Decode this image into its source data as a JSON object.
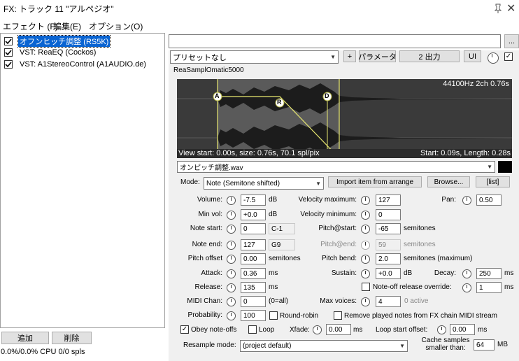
{
  "window": {
    "title": "FX: トラック 11 \"アルペジオ\""
  },
  "menu": [
    "エフェクト (F)",
    "編集(E)",
    "オプション(O)"
  ],
  "fx_list": [
    {
      "label": "オフンヒッチ調整 (RS5K)",
      "checked": true,
      "selected": true
    },
    {
      "label": "VST: ReaEQ (Cockos)",
      "checked": true,
      "selected": false
    },
    {
      "label": "VST: A1StereoControl (A1AUDIO.de)",
      "checked": true,
      "selected": false
    }
  ],
  "bottom": {
    "add_label": "追加",
    "remove_label": "削除",
    "cpu": "0.0%/0.0% CPU 0/0 spls"
  },
  "top_bar": {
    "preset_field": "",
    "more_label": "...",
    "preset": "プリセットなし",
    "plus_label": "+",
    "param_label": "パラメータ",
    "output_label": "2 出力",
    "ui_label": "UI"
  },
  "plugin": {
    "name": "ReaSamplOmatic5000"
  },
  "waveform": {
    "info": "44100Hz 2ch 0.76s",
    "view_info": "View start: 0.00s, size: 0.76s, 70.1 spl/pix",
    "sel_info": "Start: 0.09s, Length: 0.28s",
    "markers": {
      "a": "A",
      "r": "R",
      "d": "D"
    }
  },
  "file": {
    "name": "オンピッチ調整.wav"
  },
  "mode": {
    "label": "Mode:",
    "value": "Note (Semitone shifted)",
    "import_label": "Import item from arrange",
    "browse_label": "Browse...",
    "list_label": "[list]"
  },
  "params": {
    "volume": {
      "label": "Volume:",
      "value": "-7.5",
      "unit": "dB"
    },
    "min_vol": {
      "label": "Min vol:",
      "value": "+0.0",
      "unit": "dB"
    },
    "note_start": {
      "label": "Note start:",
      "value": "0",
      "note": "C-1"
    },
    "note_end": {
      "label": "Note end:",
      "value": "127",
      "note": "G9"
    },
    "pitch_offset": {
      "label": "Pitch offset",
      "value": "0.00",
      "unit": "semitones"
    },
    "attack": {
      "label": "Attack:",
      "value": "0.36",
      "unit": "ms"
    },
    "release": {
      "label": "Release:",
      "value": "135",
      "unit": "ms"
    },
    "midi_chan": {
      "label": "MIDI Chan:",
      "value": "0",
      "unit": "(0=all)"
    },
    "probability": {
      "label": "Probability:",
      "value": "100"
    },
    "vel_max": {
      "label": "Velocity maximum:",
      "value": "127"
    },
    "vel_min": {
      "label": "Velocity minimum:",
      "value": "0"
    },
    "pitch_start": {
      "label": "Pitch@start:",
      "value": "-65",
      "unit": "semitones"
    },
    "pitch_end": {
      "label": "Pitch@end:",
      "value": "59",
      "unit": "semitones"
    },
    "pitch_bend": {
      "label": "Pitch bend:",
      "value": "2.0",
      "unit": "semitones (maximum)"
    },
    "sustain": {
      "label": "Sustain:",
      "value": "+0.0",
      "unit": "dB"
    },
    "max_voices": {
      "label": "Max voices:",
      "value": "4",
      "unit": "0 active"
    },
    "pan": {
      "label": "Pan:",
      "value": "0.50"
    },
    "decay": {
      "label": "Decay:",
      "value": "250",
      "unit": "ms"
    },
    "noteoff_override": {
      "label": "Note-off release override:",
      "value": "1",
      "unit": "ms"
    },
    "xfade": {
      "label": "Xfade:",
      "value": "0.00",
      "unit": "ms"
    },
    "loop_start": {
      "label": "Loop start offset:",
      "value": "0.00",
      "unit": "ms"
    }
  },
  "checks": {
    "round_robin": {
      "label": "Round-robin",
      "checked": false
    },
    "remove_played": {
      "label": "Remove played notes from FX chain MIDI stream",
      "checked": false
    },
    "obey_noteoffs": {
      "label": "Obey note-offs",
      "checked": true
    },
    "loop": {
      "label": "Loop",
      "checked": false
    }
  },
  "resample": {
    "label": "Resample mode:",
    "value": "(project default)"
  },
  "cache": {
    "label1": "Cache samples",
    "label2": "smaller than:",
    "value": "64",
    "unit": "MB"
  }
}
